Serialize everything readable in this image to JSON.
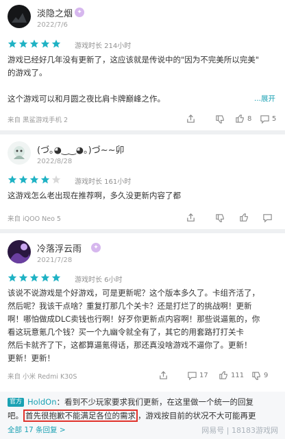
{
  "reviews": [
    {
      "username": "淡隐之烟",
      "date": "2022/7/6",
      "rating": 5,
      "playtime": "游戏时长 214小时",
      "text_lines": [
        "游戏已经好几年没有更新了，这应该就是传说中的\"因为不完美所以完美\"",
        "的游戏了。",
        "",
        "这个游戏可以和月圆之夜比肩卡牌巅峰之作。"
      ],
      "expand": "...展开",
      "device": "来自 黑鲨游戏手机 2",
      "likes": "8",
      "comments": "5"
    },
    {
      "username": "(づ｡◕‿‿◕｡)づ~~卯",
      "date": "2022/8/28",
      "rating": 4,
      "playtime": "游戏时长 161小时",
      "text_lines": [
        "这游戏怎么老出现在推荐啊，多久没更新内容了都"
      ],
      "device": "来自 iQOO Neo 5"
    },
    {
      "username": "冷落浮云雨",
      "date": "2021/7/28",
      "rating": 5,
      "playtime": "游戏时长 6小时",
      "text_lines": [
        "该说不说游戏是个好游戏，可是更新呢？这个版本多久了。卡组齐活了，",
        "然后呢？我该干点啥？重复打那几个关卡？还是打烂了的挑战啊！更新",
        "啊！哪怕做成DLC卖钱也行啊！好歹你更新点内容啊！那些说逼氪的，你",
        "看这玩意氪几个钱？买一个九幽令就全有了，其它的用套路打打关卡",
        "然后卡就齐了下，这都算逼氪得话，那还真没啥游戏不逼你了。更新！",
        "更新！更新！"
      ],
      "device": "来自 小米 Redmi K30S",
      "comments": "17",
      "likes": "111",
      "dislikes": "9"
    }
  ],
  "official_reply": {
    "tag": "官方",
    "author": "HoldOn",
    "line1_rest": "：看到不少玩家要求我们更新，在这里做一个统一的回复",
    "line2_pre": "吧。",
    "highlighted": "首先很抱歉不能满足各位的需求",
    "line2_post": "，游戏按目前的状况不大可能再更",
    "more": "全部 17 条回复 >"
  },
  "watermark": "网易号 | 18183游戏网",
  "colors": {
    "accent": "#1aa1b3",
    "star": "#1fb2c4",
    "highlight_border": "#e0312a"
  }
}
